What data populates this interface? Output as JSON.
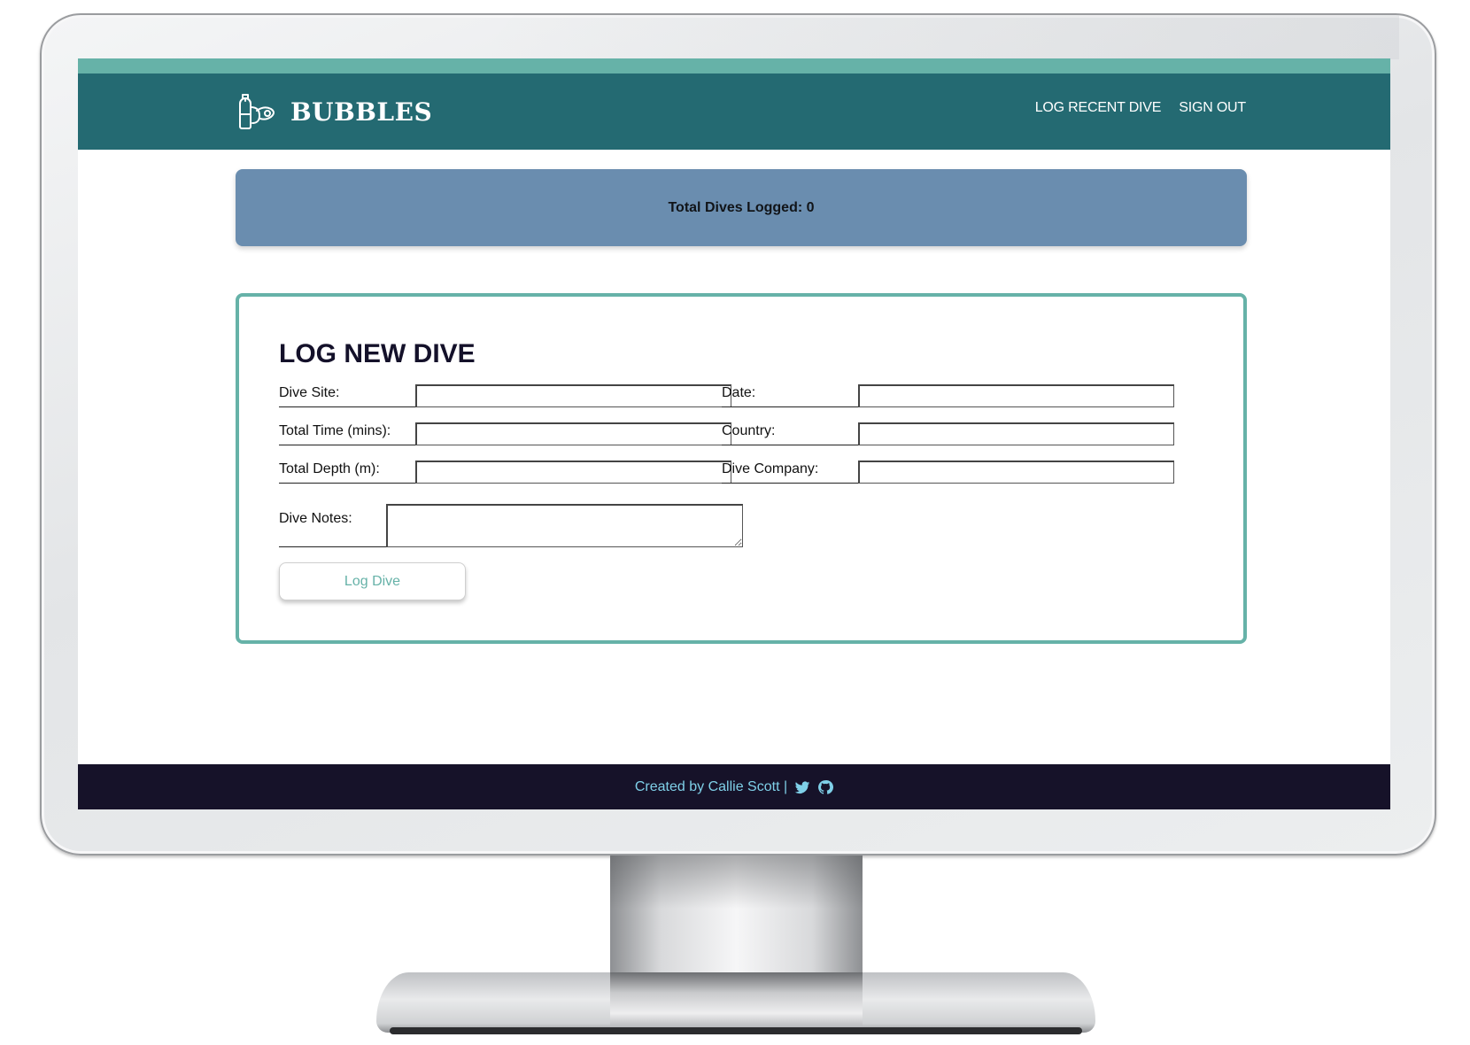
{
  "header": {
    "brand": "BUBBLES",
    "nav": [
      "LOG RECENT DIVE",
      "SIGN OUT"
    ]
  },
  "stats": {
    "text": "Total Dives Logged: 0"
  },
  "form": {
    "title": "LOG NEW DIVE",
    "left_fields": [
      "Dive Site:",
      "Total Time (mins):",
      "Total Depth (m):"
    ],
    "right_fields": [
      "Date:",
      "Country:",
      "Dive Company:"
    ],
    "notes_label": "Dive Notes:",
    "submit": "Log Dive"
  },
  "footer": {
    "credit": "Created by Callie Scott |",
    "icons": [
      "twitter-icon",
      "github-icon"
    ]
  },
  "colors": {
    "accent": "#66b2a8",
    "header": "#246a72",
    "stats": "#6a8daf",
    "footer": "#161229",
    "footer_text": "#7fd0e8"
  }
}
